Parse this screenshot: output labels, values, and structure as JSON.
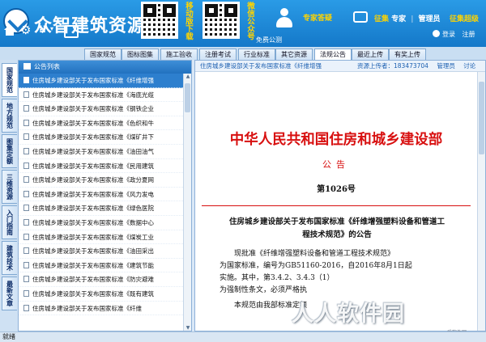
{
  "app": {
    "title": "众智建筑资源",
    "qr_label_1": "移动版下载",
    "qr_label_2": "微信公众号",
    "free_text": "免费公测",
    "expert_label": "专家答疑",
    "top_links": [
      "征集",
      "专家",
      "管理员"
    ],
    "top_right_link": "征集超级",
    "login": "登录",
    "register": "注册"
  },
  "tabs": [
    {
      "label": "国家规范",
      "active": false
    },
    {
      "label": "图标图集",
      "active": false
    },
    {
      "label": "施工验收",
      "active": false
    },
    {
      "label": "注册考试",
      "active": false
    },
    {
      "label": "行业标准",
      "active": false
    },
    {
      "label": "其它资源",
      "active": false
    },
    {
      "label": "法规公告",
      "active": true
    },
    {
      "label": "最近上传",
      "active": false
    },
    {
      "label": "有奖上传",
      "active": false
    }
  ],
  "vertical_tabs": [
    {
      "label": "国家规范",
      "active": true
    },
    {
      "label": "地方规范",
      "active": false
    },
    {
      "label": "图集定额",
      "active": false
    },
    {
      "label": "三维资源",
      "active": false
    },
    {
      "label": "入门指南",
      "active": false
    },
    {
      "label": "建筑技术",
      "active": false
    },
    {
      "label": "最新文章",
      "active": false
    }
  ],
  "list_panel": {
    "title": "公告列表",
    "rows": [
      "住房城乡建设部关于发布国家标准《纤维增强",
      "住房城乡建设部关于发布国家标准《海底光缆",
      "住房城乡建设部关于发布国家标准《钢铁企业",
      "住房城乡建设部关于发布国家标准《色织和牛",
      "住房城乡建设部关于发布国家标准《煤矿井下",
      "住房城乡建设部关于发布国家标准《油田油气",
      "住房城乡建设部关于发布国家标准《民用建筑",
      "住房城乡建设部关于发布国家标准《政分夏网",
      "住房城乡建设部关于发布国家标准《风力发电",
      "住房城乡建设部关于发布国家标准《绿色医院",
      "住房城乡建设部关于发布国家标准《数据中心",
      "住房城乡建设部关于发布国家标准《煤炭工业",
      "住房城乡建设部关于发布国家标准《油田采出",
      "住房城乡建设部关于发布国家标准《建筑节能",
      "住房城乡建设部关于发布国家标准《防灾避难",
      "住房城乡建设部关于发布国家标准《既有建筑",
      "住房城乡建设部关于发布国家标准《纤维"
    ]
  },
  "document": {
    "breadcrumb": "住房城乡建设部关于发布国家标准《纤维增强",
    "uploader": "资源上传者：183473704",
    "admin": "管理员",
    "discuss": "讨论",
    "title": "中华人民共和国住房和城乡建设部",
    "subtitle": "公告",
    "number": "第1026号",
    "heading": "住房城乡建设部关于发布国家标准《纤维增强塑料设备和管道工程技术规范》的公告",
    "paragraph_lines": [
      "现批准《纤维增强塑料设备和管道工程技术规范》",
      "为国家标准，编号为GB51160-2016，自2016年8月1日起",
      "实施。其中，第3.4.2、3.4.3（1）",
      "为强制性条文，必须严格执",
      "本规范由我部标准定额"
    ]
  },
  "watermark": "人人软件园",
  "watermark_sub": "爱软件网",
  "status": "就绪"
}
